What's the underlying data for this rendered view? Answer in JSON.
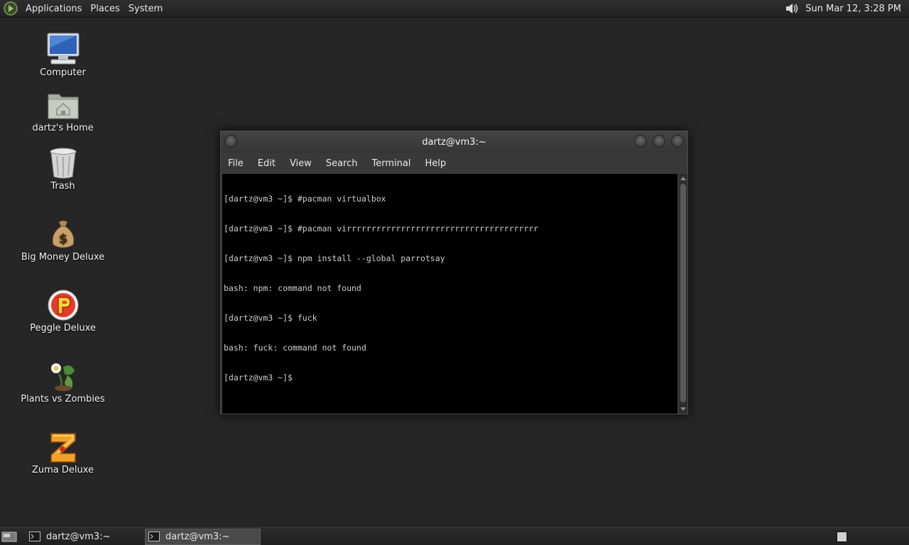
{
  "top_panel": {
    "menus": [
      "Applications",
      "Places",
      "System"
    ],
    "clock": "Sun Mar 12,  3:28 PM",
    "volume_icon": "speaker-icon",
    "logo_icon": "gnome-foot-icon"
  },
  "desktop_icons": [
    {
      "label": "Computer",
      "icon": "computer-icon"
    },
    {
      "label": "dartz's Home",
      "icon": "home-folder-icon"
    },
    {
      "label": "Trash",
      "icon": "trash-icon"
    },
    {
      "label": "Big Money Deluxe",
      "icon": "money-bag-icon"
    },
    {
      "label": "Peggle Deluxe",
      "icon": "peggle-icon"
    },
    {
      "label": "Plants vs Zombies",
      "icon": "plants-vs-zombies-icon"
    },
    {
      "label": "Zuma Deluxe",
      "icon": "zuma-icon"
    }
  ],
  "terminal": {
    "title": "dartz@vm3:~",
    "menu": [
      "File",
      "Edit",
      "View",
      "Search",
      "Terminal",
      "Help"
    ],
    "lines": [
      "[dartz@vm3 ~]$ #pacman virtualbox",
      "[dartz@vm3 ~]$ #pacman virrrrrrrrrrrrrrrrrrrrrrrrrrrrrrrrrrrrrrr",
      "[dartz@vm3 ~]$ npm install --global parrotsay",
      "bash: npm: command not found",
      "[dartz@vm3 ~]$ fuck",
      "bash: fuck: command not found",
      "[dartz@vm3 ~]$ "
    ]
  },
  "bottom_panel": {
    "tasks": [
      {
        "label": "dartz@vm3:~",
        "active": false
      },
      {
        "label": "dartz@vm3:~",
        "active": true
      }
    ]
  },
  "colors": {
    "desktop_bg": "#262626",
    "panel_bg": "#282828",
    "terminal_bg": "#000000",
    "terminal_fg": "#cfcfcf"
  }
}
